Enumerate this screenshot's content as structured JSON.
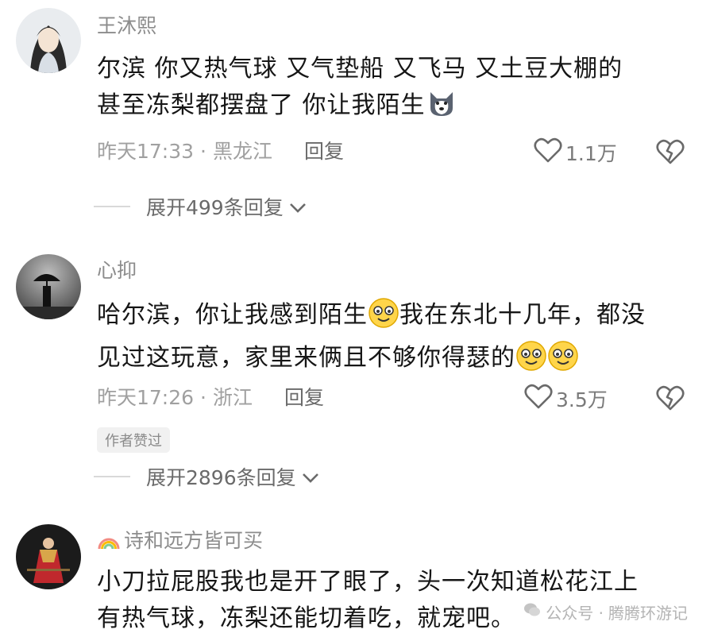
{
  "comments": [
    {
      "username": "王沐熙",
      "text_1": "尔滨  你又热气球  又气垫船   又飞马  又土豆大棚的",
      "text_2": "甚至冻梨都摆盘了  你让我陌生",
      "time": "昨天17:33",
      "sep": "·",
      "location": "黑龙江",
      "reply_label": "回复",
      "likes": "1.1万",
      "expand_label": "展开499条回复"
    },
    {
      "username": "心抑",
      "text_1": "哈尔滨，你让我感到陌生",
      "text_1b": "我在东北十几年，都没",
      "text_2": "见过这玩意，家里来俩且不够你得瑟的",
      "time": "昨天17:26",
      "sep": "·",
      "location": "浙江",
      "reply_label": "回复",
      "likes": "3.5万",
      "badge": "作者赞过",
      "expand_label": "展开2896条回复"
    },
    {
      "username": "诗和远方皆可买",
      "text_1": "小刀拉屁股我也是开了眼了，头一次知道松花江上",
      "text_2": "有热气球，冻梨还能切着吃，就宠吧。"
    }
  ],
  "watermark": {
    "prefix": "公众号 · ",
    "name": "腾腾环游记"
  }
}
